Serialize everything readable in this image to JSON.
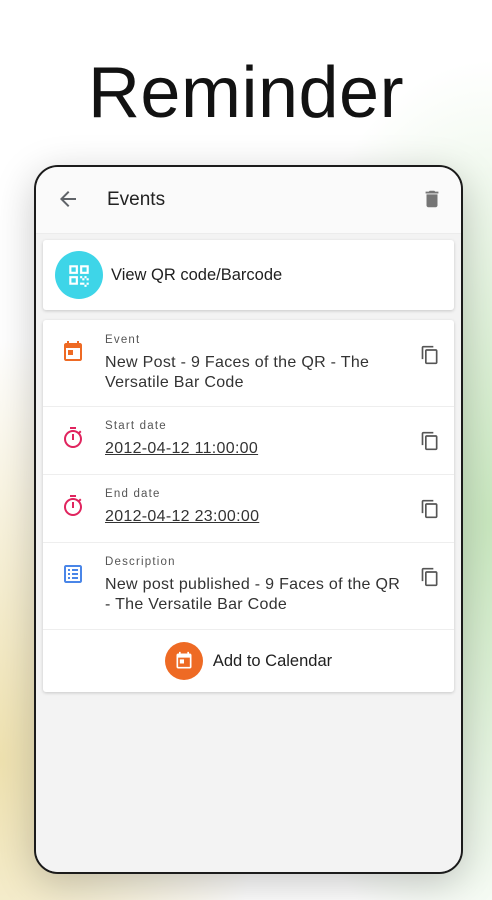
{
  "hero": {
    "title": "Reminder"
  },
  "appbar": {
    "title": "Events"
  },
  "qr": {
    "label": "View QR code/Barcode"
  },
  "details": {
    "event": {
      "label": "Event",
      "value": "New Post - 9 Faces of the QR - The Versatile Bar Code"
    },
    "start": {
      "label": "Start date",
      "value": "2012-04-12 11:00:00"
    },
    "end": {
      "label": "End date",
      "value": "2012-04-12 23:00:00"
    },
    "description": {
      "label": "Description",
      "value": "New post published - 9 Faces of the QR - The Versatile Bar Code"
    }
  },
  "action": {
    "label": "Add to Calendar"
  },
  "colors": {
    "qr_accent": "#3ed5e8",
    "calendar_accent": "#ee6a24",
    "timer_accent": "#e0245e",
    "list_accent": "#4a86e8"
  },
  "icons": [
    "back-arrow-icon",
    "trash-icon",
    "qr-code-icon",
    "calendar-icon",
    "timer-icon",
    "list-icon",
    "copy-icon"
  ]
}
